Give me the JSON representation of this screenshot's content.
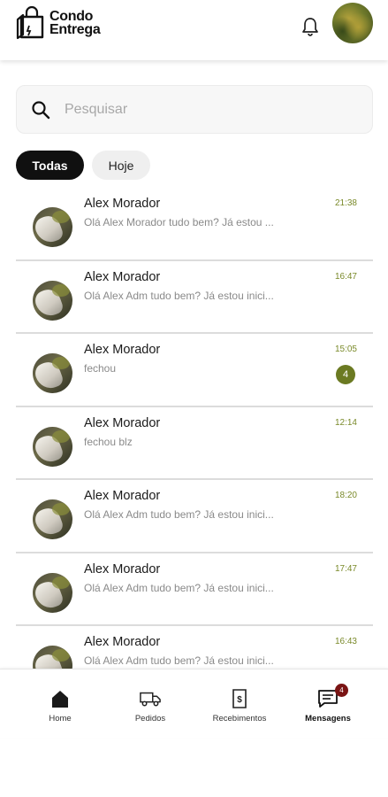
{
  "header": {
    "logo_line1": "Condo",
    "logo_line2": "Entrega"
  },
  "search": {
    "placeholder": "Pesquisar"
  },
  "filters": [
    {
      "label": "Todas",
      "active": true
    },
    {
      "label": "Hoje",
      "active": false
    }
  ],
  "conversations": [
    {
      "name": "Alex Morador",
      "preview": "Olá Alex Morador tudo bem? Já estou ...",
      "time": "21:38",
      "unread": null
    },
    {
      "name": "Alex Morador",
      "preview": "Olá Alex Adm tudo bem? Já estou inici...",
      "time": "16:47",
      "unread": null
    },
    {
      "name": "Alex Morador",
      "preview": "fechou",
      "time": "15:05",
      "unread": "4"
    },
    {
      "name": "Alex Morador",
      "preview": "fechou blz",
      "time": "12:14",
      "unread": null
    },
    {
      "name": "Alex Morador",
      "preview": "Olá Alex Adm tudo bem? Já estou inici...",
      "time": "18:20",
      "unread": null
    },
    {
      "name": "Alex Morador",
      "preview": "Olá Alex Adm tudo bem? Já estou inici...",
      "time": "17:47",
      "unread": null
    },
    {
      "name": "Alex Morador",
      "preview": "Olá Alex Adm tudo bem? Já estou inici...",
      "time": "16:43",
      "unread": null
    }
  ],
  "bottom_nav": {
    "items": [
      {
        "label": "Home",
        "icon": "home-icon"
      },
      {
        "label": "Pedidos",
        "icon": "truck-icon"
      },
      {
        "label": "Recebimentos",
        "icon": "receipt-icon"
      },
      {
        "label": "Mensagens",
        "icon": "message-icon",
        "badge": "4",
        "active": true
      }
    ]
  },
  "colors": {
    "accent": "#6b7a22",
    "chip_active": "#101010",
    "badge_nav": "#7a1414"
  }
}
